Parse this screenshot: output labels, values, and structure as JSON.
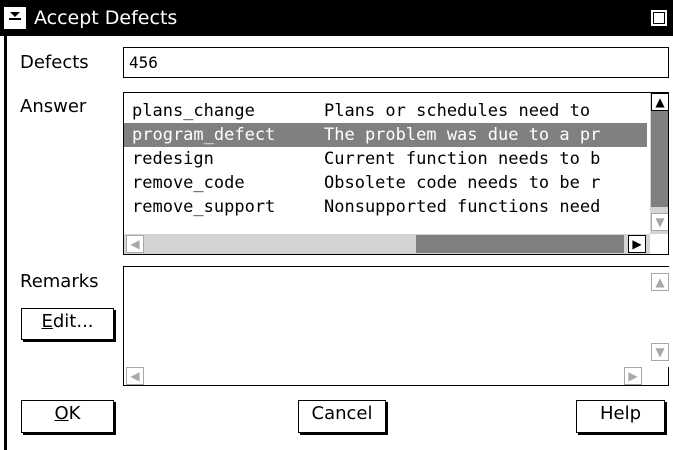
{
  "window": {
    "title": "Accept Defects"
  },
  "defects": {
    "label": "Defects",
    "value": "456"
  },
  "answer": {
    "label": "Answer",
    "items": [
      {
        "code": "plans_change",
        "description": "Plans or schedules need to"
      },
      {
        "code": "program_defect",
        "description": "The problem was due to a pr"
      },
      {
        "code": "redesign",
        "description": "Current function needs to b"
      },
      {
        "code": "remove_code",
        "description": "Obsolete code needs to be r"
      },
      {
        "code": "remove_support",
        "description": "Nonsupported functions need"
      }
    ],
    "selected_index": 1
  },
  "remarks": {
    "label": "Remarks",
    "value": ""
  },
  "buttons": {
    "edit": {
      "mnemonic": "E",
      "rest": "dit..."
    },
    "ok": {
      "mnemonic": "O",
      "rest": "K"
    },
    "cancel": "Cancel",
    "help": "Help"
  },
  "icons": {
    "system_menu": "system-menu-icon",
    "maximize": "maximize-icon",
    "scroll_up": "scroll-up-arrow-icon",
    "scroll_down": "scroll-down-arrow-icon",
    "scroll_left": "scroll-left-arrow-icon",
    "scroll_right": "scroll-right-arrow-icon"
  }
}
